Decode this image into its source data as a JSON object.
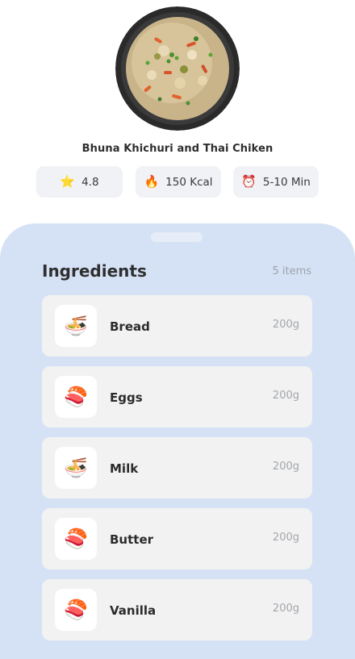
{
  "dish": {
    "title": "Bhuna Khichuri and Thai Chiken",
    "image": "fried-rice-bowl"
  },
  "stats": {
    "rating": {
      "icon": "star-icon",
      "value": "4.8"
    },
    "calories": {
      "icon": "fire-icon",
      "value": "150 Kcal"
    },
    "time": {
      "icon": "alarm-clock-icon",
      "value": "5-10 Min"
    }
  },
  "ingredients": {
    "title": "Ingredients",
    "count": "5 items",
    "items": [
      {
        "name": "Bread",
        "qty": "200g",
        "icon": "noodle-bowl-icon"
      },
      {
        "name": "Eggs",
        "qty": "200g",
        "icon": "sushi-icon"
      },
      {
        "name": "Milk",
        "qty": "200g",
        "icon": "noodle-bowl-icon"
      },
      {
        "name": "Butter",
        "qty": "200g",
        "icon": "sushi-icon"
      },
      {
        "name": "Vanilla",
        "qty": "200g",
        "icon": "sushi-icon"
      }
    ]
  },
  "colors": {
    "sheet_background": "#d5e2f6",
    "card_background": "#f2f2f2",
    "stat_background": "#f1f2f5"
  }
}
